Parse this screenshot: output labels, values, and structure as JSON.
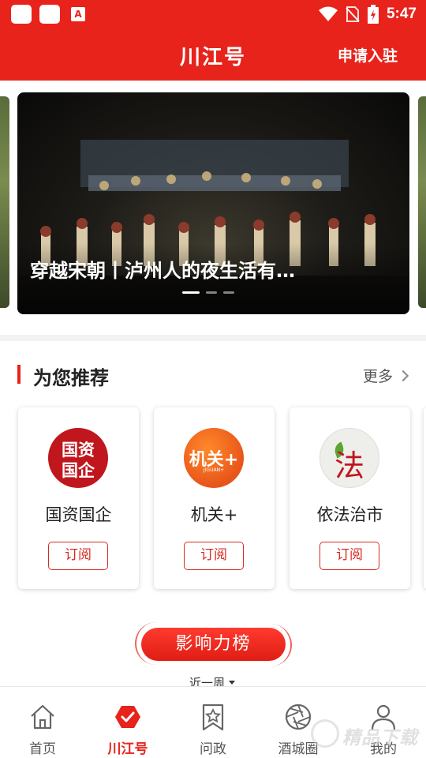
{
  "app": {
    "title": "川江号",
    "apply_label": "申请入驻",
    "accent_color": "#e8231b"
  },
  "status_bar": {
    "time": "5:47",
    "left_icons": [
      "app-icon",
      "app-icon",
      "font-icon"
    ],
    "right_icons": [
      "wifi-icon",
      "no-sim-icon",
      "battery-charging-icon"
    ]
  },
  "banner": {
    "caption": "穿越宋朝丨泸州人的夜生活有…",
    "slide_count": 3,
    "active_slide": 1
  },
  "recommend": {
    "title": "为您推荐",
    "more_label": "更多",
    "items": [
      {
        "name": "国资国企",
        "logo_text": [
          "国资",
          "国企"
        ],
        "subscribe_label": "订阅"
      },
      {
        "name": "机关+",
        "logo_text": [
          "机关+",
          "JIGUAN+"
        ],
        "subscribe_label": "订阅"
      },
      {
        "name": "依法治市",
        "logo_text": [
          "法"
        ],
        "subscribe_label": "订阅"
      }
    ]
  },
  "ranking": {
    "button_label": "影响力榜",
    "period_label": "近一周"
  },
  "bottom_nav": [
    {
      "label": "首页",
      "icon": "home-icon",
      "active": false
    },
    {
      "label": "川江号",
      "icon": "hexagon-check-icon",
      "active": true
    },
    {
      "label": "问政",
      "icon": "bookmark-star-icon",
      "active": false
    },
    {
      "label": "酒城圈",
      "icon": "aperture-icon",
      "active": false
    },
    {
      "label": "我的",
      "icon": "user-icon",
      "active": false
    }
  ],
  "watermark": {
    "text": "精品下载"
  }
}
